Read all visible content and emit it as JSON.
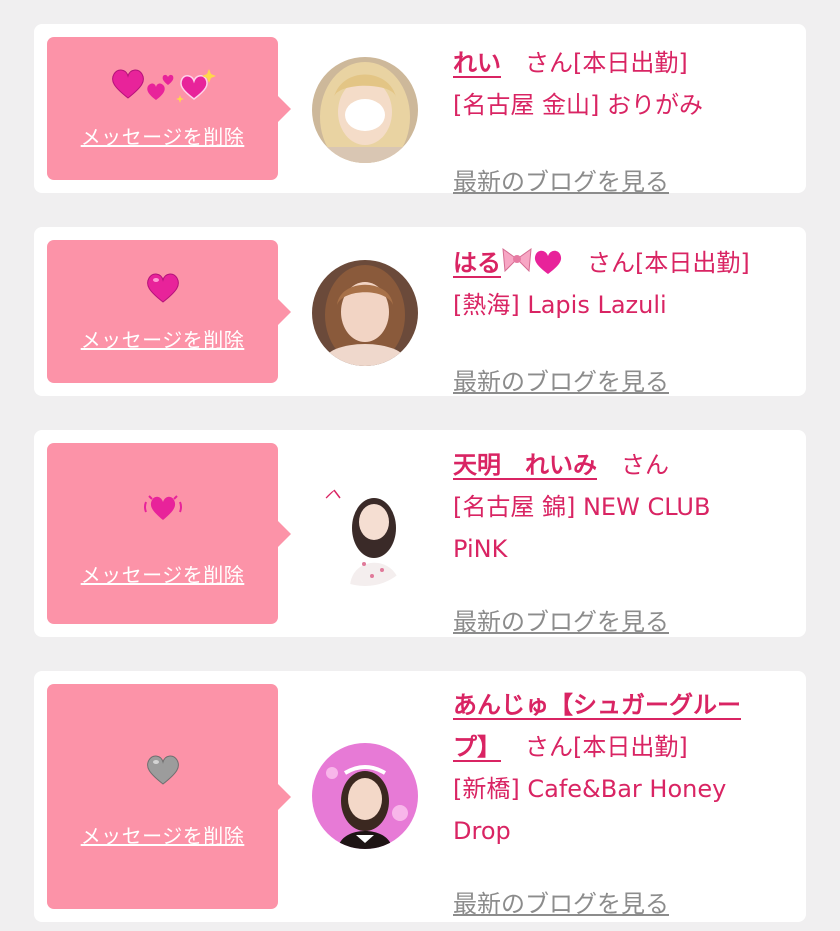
{
  "colors": {
    "page_bg": "#f0eff0",
    "card_bg": "#ffffff",
    "bubble_bg": "#fc93a8",
    "accent": "#d92463",
    "muted": "#8c8c8c"
  },
  "cards": [
    {
      "stickers": [
        "heart-icon",
        "two-hearts-icon",
        "sparkling-heart-icon"
      ],
      "delete_label": "メッセージを削除",
      "name": "れい",
      "honorific": "さん[本日出勤]",
      "shop_line1": "[名古屋 金山] おりがみ",
      "shop_line2": "",
      "blog_label": "最新のブログを見る"
    },
    {
      "stickers": [
        "heart-icon"
      ],
      "delete_label": "メッセージを削除",
      "name": "はる",
      "name_icons": [
        "ribbon-icon",
        "heart-icon"
      ],
      "honorific": "さん[本日出勤]",
      "shop_line1": "[熱海] Lapis Lazuli",
      "shop_line2": "",
      "blog_label": "最新のブログを見る"
    },
    {
      "stickers": [
        "beating-heart-icon"
      ],
      "delete_label": "メッセージを削除",
      "name": "天明　れいみ",
      "honorific": "さん",
      "shop_line1": "[名古屋 錦] NEW CLUB",
      "shop_line2": "PiNK",
      "blog_label": "最新のブログを見る"
    },
    {
      "stickers": [
        "grey-heart-icon"
      ],
      "delete_label": "メッセージを削除",
      "name_line1": "あんじゅ【シュガーグルー",
      "name_line2": "プ】",
      "honorific": "さん[本日出勤]",
      "shop_line1": "[新橋] Cafe&Bar Honey",
      "shop_line2": "Drop",
      "blog_label": "最新のブログを見る"
    }
  ]
}
